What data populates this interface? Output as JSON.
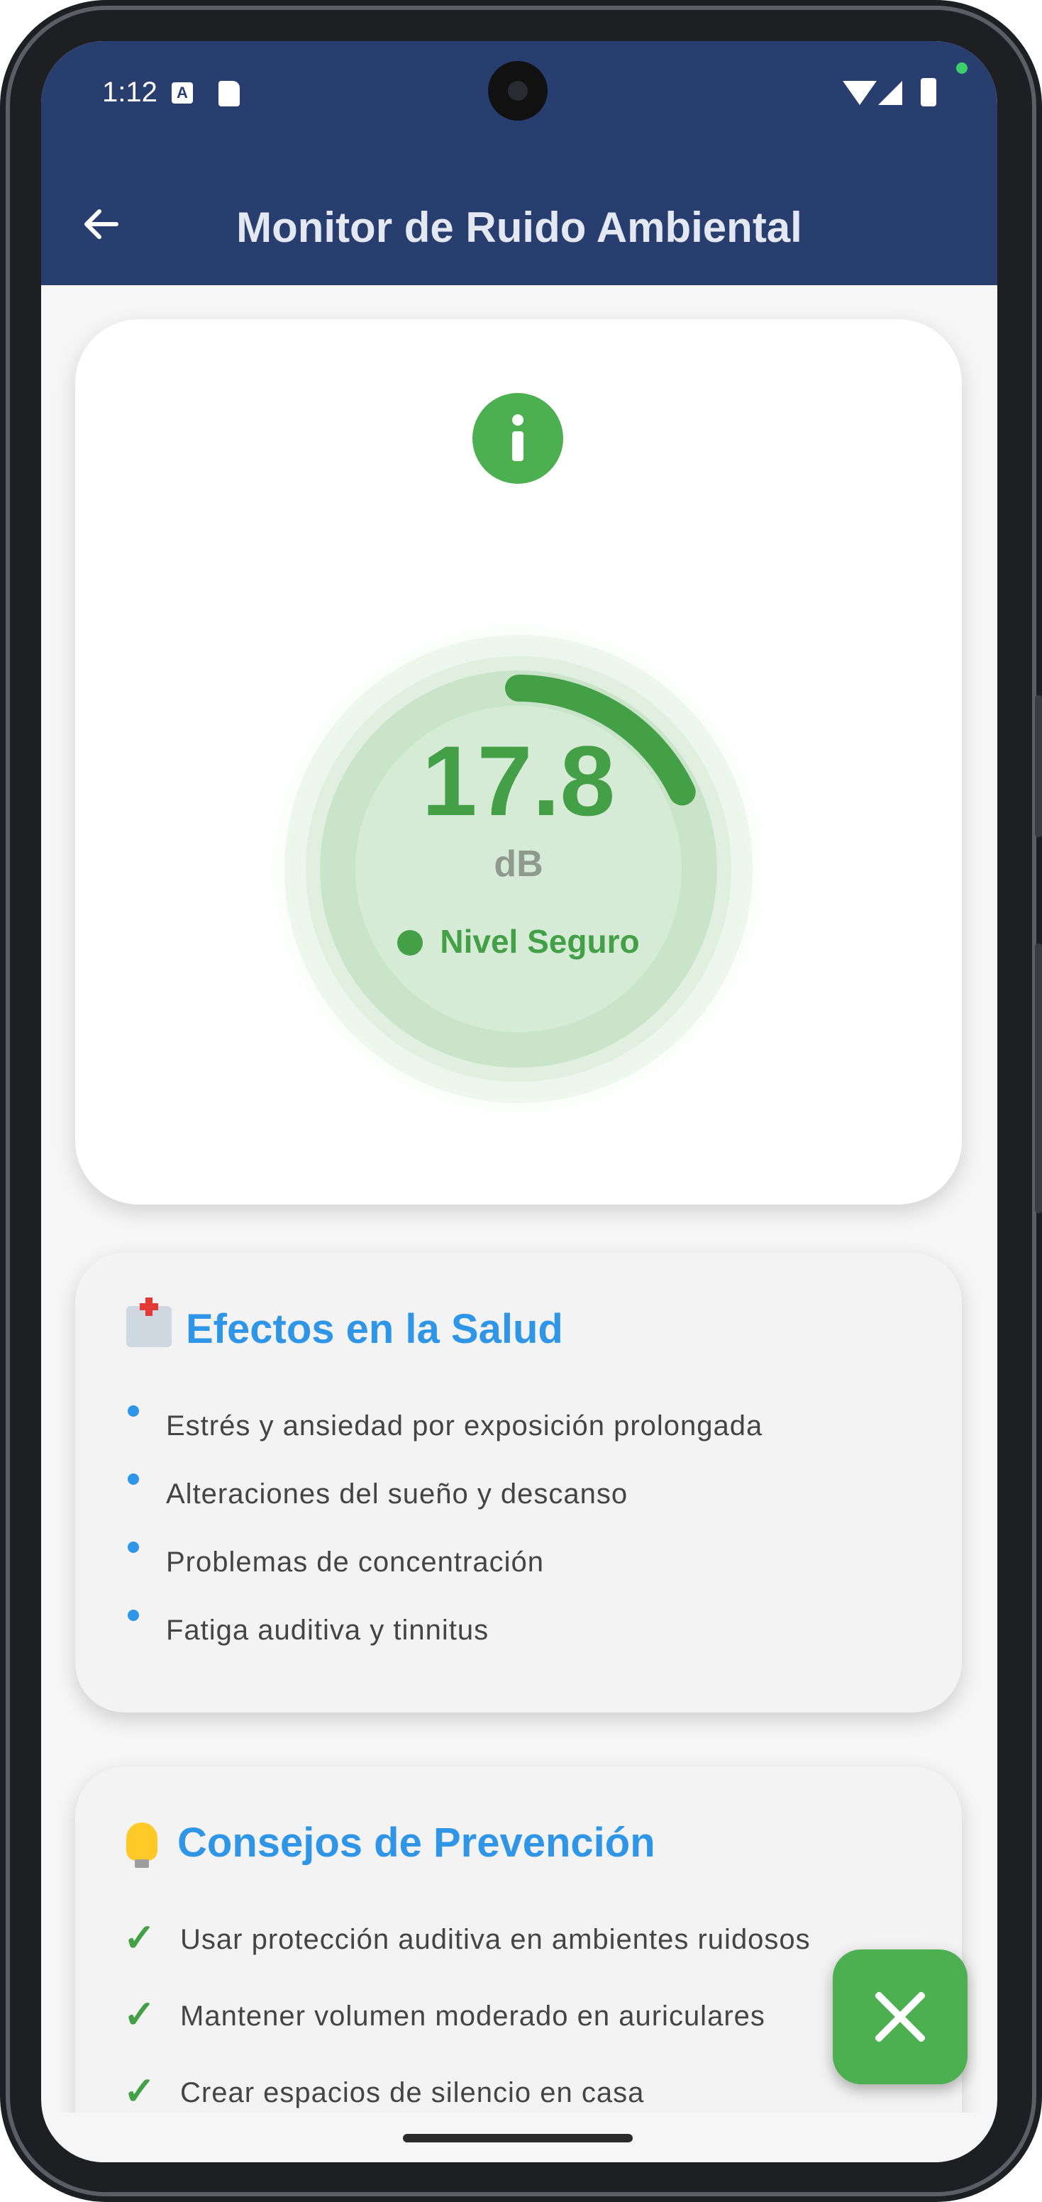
{
  "status_bar": {
    "time": "1:12",
    "icons": [
      "a-icon",
      "sd-card-icon",
      "wifi-icon",
      "signal-icon",
      "battery-icon"
    ]
  },
  "app_bar": {
    "title": "Monitor de Ruido Ambiental",
    "back_icon": "arrow-left-icon"
  },
  "meter": {
    "value": "17.8",
    "unit": "dB",
    "status": "Nivel Seguro",
    "level_fraction": 0.18,
    "color": "#43a047"
  },
  "health_card": {
    "title": "Efectos en la Salud",
    "icon": "hospital-icon",
    "items": [
      "Estrés y ansiedad por exposición prolongada",
      "Alteraciones del sueño y descanso",
      "Problemas de concentración",
      "Fatiga auditiva y tinnitus"
    ]
  },
  "tips_card": {
    "title": "Consejos de Prevención",
    "icon": "lightbulb-icon",
    "items": [
      "Usar protección auditiva en ambientes ruidosos",
      "Mantener volumen moderado en auriculares",
      "Crear espacios de silencio en casa"
    ]
  },
  "fab": {
    "icon": "close-icon"
  },
  "colors": {
    "app_bar": "#283e6e",
    "accent_green": "#4caf50",
    "accent_blue": "#2f95e6"
  }
}
